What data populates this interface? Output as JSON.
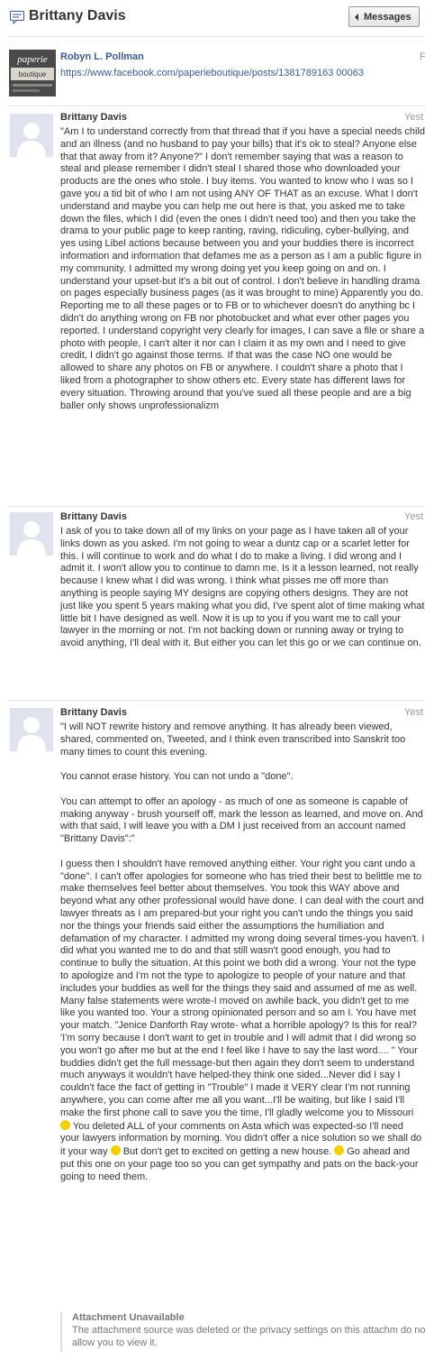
{
  "header": {
    "title": "Brittany Davis",
    "back_label": "Messages"
  },
  "shared": {
    "logo_text_1": "paperie",
    "logo_text_2": "boutique",
    "name": "Robyn L. Pollman",
    "link": "https://www.facebook.com/paperieboutique/posts/1381789163 00063",
    "f_tag": "F"
  },
  "messages": [
    {
      "author": "Brittany Davis",
      "time": "Yest",
      "body": "\"Am I to understand correctly from that thread that if you have a special needs child and an illness (and no husband to pay your bills) that it's ok to steal? Anyone else that that away from it? Anyone?\" I don't remember saying that was a reason to steal and please remember I didn't steal I shared those who downloaded your products are the ones who stole. I buy items. You wanted to know who I was so I gave you a tid bit of who I am not using ANY OF THAT as an excuse. What I don't understand and maybe you can help me out here is that, you asked me to take down the files, which I did (even the ones I didn't need too) and then you take the drama to your public page to keep ranting, raving, ridiculing, cyber-bullying, and yes using Libel actions because between you and your buddies there is incorrect information and information that defames me as a person as I am a public figure in my community. I admitted my wrong doing yet you keep going on and on. I understand your upset-but it's a bit out of control. I don't believe in handling drama on pages especially business pages (as it was brought to mine) Apparently you do. Reporting me to all these pages or to FB or to whichever doesn't do anything bc I didn't do anything wrong on FB nor photobucket and what ever other pages you reported. I understand copyright very clearly for images, I can save a file or share a photo with people, I can't alter it nor can I claim it as my own and I need to give credit, I didn't go against those terms. If that was the case NO one would be allowed to share any photos on FB or anywhere. I couldn't share a photo that I liked from a photographer to show others etc. Every state has different laws for every situation. Throwing around that you've sued all these people and are a big baller only shows unprofessionalizm"
    },
    {
      "author": "Brittany Davis",
      "time": "Yest",
      "body": "I ask of you to take down all of my links on your page as I have taken all of your links down as you asked. I'm not going to wear a duntz cap or a scarlet letter for this. I will continue to work and do what I do to make a living. I did wrong and I admit it. I won't allow you to continue to damn me. Is it a lesson learned, not really because I knew what I did was wrong. I think what pisses me off more than anything is people saying MY designs are copying others designs. They are not just like you spent 5 years making what you did, I've spent alot of time making what little bit I have designed as well. Now it is up to you if you want me to call your lawyer in the morning or not. I'm not backing down or running away or trying to avoid anything, I'll deal with it. But either you can let this go or we can continue on."
    },
    {
      "author": "Brittany Davis",
      "time": "Yest",
      "body_1": "\"I will NOT rewrite history and remove anything. It has already been viewed, shared, commented on, Tweeted, and I think even transcribed into Sanskrit too many times to count this evening.\n\nYou cannot erase history. You can not undo a \"done\".\n\nYou can attempt to offer an apology - as much of one as someone is capable of making anyway - brush yourself off, mark the lesson as learned, and move on. And with that said, I will leave you with a DM I just received from an account named \"Brittany Davis\":\"\n\nI guess then I shouldn't have removed anything either. Your right you cant undo a \"done\". I can't offer apologies for someone who has tried their best to belittle me to make themselves feel better about themselves. You took this WAY above and beyond what any other professional would have done. I can deal with the court and lawyer threats as I am prepared-but your right you can't undo the things you said nor the things your friends said either the assumptions the humiliation and defamation of my character. I admitted my wrong doing several times-you haven't. I did what you wanted me to do and that still wasn't good enough, you had to continue to bully the situation. At this point we both did a wrong. Your not the type to apologize and I'm not the type to apologize to people of your nature and that includes your buddies as well for the things they said and assumed of me as well. Many false statements were wrote-I moved on awhile back, you didn't get to me like you wanted too. Your a strong opinionated person and so am I. You have met your match. \"Jenice Danforth Ray wrote- what a horrible apology? Is this for real? 'I'm sorry because I don't want to get in trouble and I will admit that I did wrong so you won't go after me but at the end I feel like I have to say the last word.... \" Your buddies didn't get the full message-but then again they don't seem to understand much anyways it wouldn't have helped-they think one sided...Never did I say I couldn't face the fact of getting in \"Trouble\" I made it VERY clear I'm not running anywhere, you can come after me all you want...I'll be waiting, but like I said I'll make the first phone call to save you the time, I'll gladly welcome you to Missouri ",
      "body_2": " You deleted ALL of your comments on Asta which was expected-so I'll need your lawyers information by morning. You didn't offer a nice solution so we shall do it your way ",
      "body_3": " But don't get to excited on getting a new house. ",
      "body_4": " Go ahead and put this one on your page too so you can get sympathy and pats on the back-your going to need them.",
      "attachment_title": "Attachment Unavailable",
      "attachment_text": "The attachment source was deleted or the privacy settings on this attachm do not allow you to view it."
    }
  ],
  "colors": {
    "link": "#3b5998",
    "avatar_bg": "#dfe3ee",
    "muted": "#999999"
  }
}
